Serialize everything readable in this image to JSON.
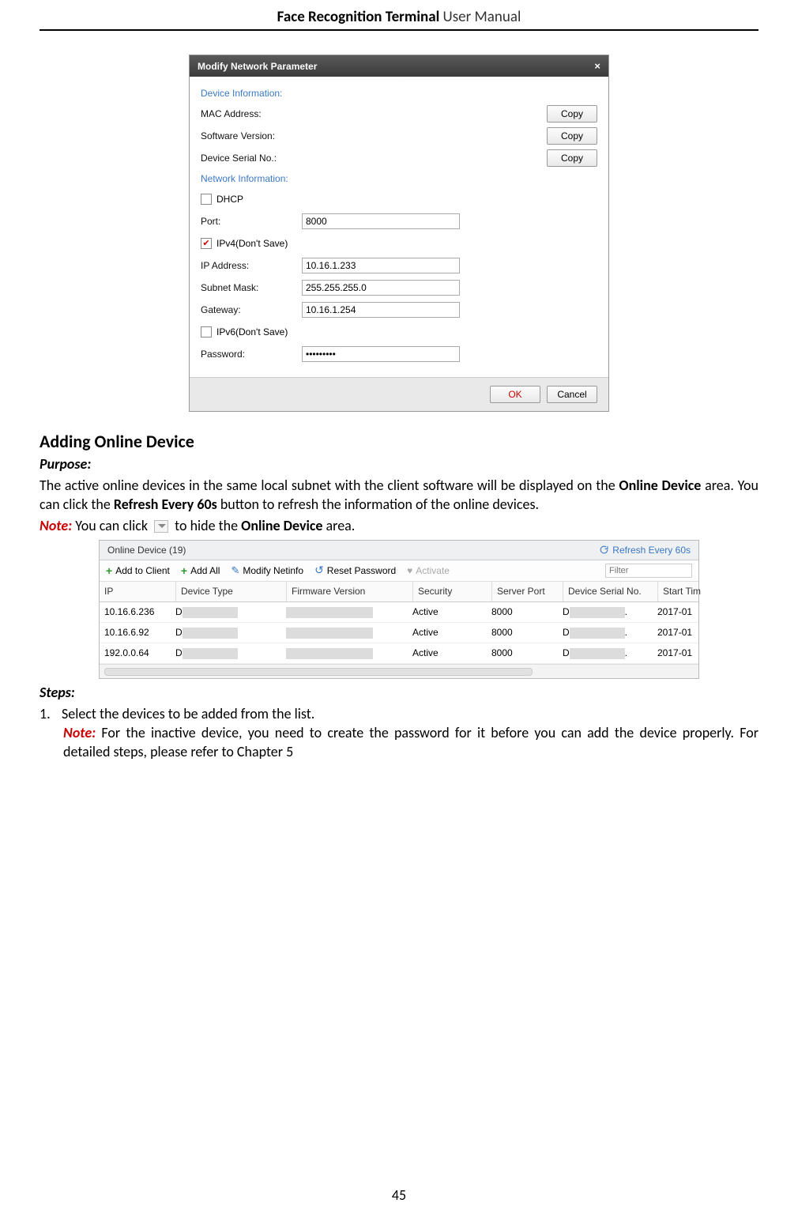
{
  "header": {
    "bold": "Face Recognition Terminal",
    "light": " User Manual"
  },
  "dialog": {
    "title": "Modify Network Parameter",
    "close": "×",
    "device_info_label": "Device Information:",
    "mac_label": "MAC Address:",
    "sw_label": "Software Version:",
    "serial_label": "Device Serial No.:",
    "copy_label": "Copy",
    "net_info_label": "Network Information:",
    "dhcp_label": "DHCP",
    "port_label": "Port:",
    "port_value": "8000",
    "ipv4save_label": "IPv4(Don't Save)",
    "ip_label": "IP Address:",
    "ip_value": "10.16.1.233",
    "subnet_label": "Subnet Mask:",
    "subnet_value": "255.255.255.0",
    "gateway_label": "Gateway:",
    "gateway_value": "10.16.1.254",
    "ipv6save_label": "IPv6(Don't Save)",
    "pwd_label": "Password:",
    "pwd_value": "•••••••••",
    "ok": "OK",
    "cancel": "Cancel"
  },
  "section_title": "Adding Online Device",
  "purpose_label": "Purpose:",
  "para1_a": "The active online devices in the same local subnet with the client software will be displayed on the ",
  "para1_b": "Online Device",
  "para1_c": " area. You can click the ",
  "para1_d": "Refresh Every 60s",
  "para1_e": " button to refresh the information of the online devices.",
  "note_label": "Note:",
  "note_text_a": " You can click ",
  "note_text_b": " to hide the ",
  "note_text_c": "Online Device",
  "note_text_d": " area.",
  "odev": {
    "title": "Online Device (19)",
    "refresh": "Refresh Every 60s",
    "add_client": "Add to Client",
    "add_all": "Add All",
    "modify": "Modify Netinfo",
    "reset": "Reset Password",
    "activate": "Activate",
    "filter_ph": "Filter",
    "cols": [
      "IP",
      "Device Type",
      "Firmware Version",
      "Security",
      "Server Port",
      "Device Serial No.",
      "Start Tim"
    ],
    "rows": [
      {
        "ip": "10.16.6.236",
        "dprefix": "D",
        "sec": "Active",
        "port": "8000",
        "sprefix": "D",
        "date": "2017-01"
      },
      {
        "ip": "10.16.6.92",
        "dprefix": "D",
        "sec": "Active",
        "port": "8000",
        "sprefix": "D",
        "date": "2017-01"
      },
      {
        "ip": "192.0.0.64",
        "dprefix": "D",
        "sec": "Active",
        "port": "8000",
        "sprefix": "D",
        "date": "2017-01"
      }
    ]
  },
  "steps_label": "Steps:",
  "step1_num": "1.",
  "step1_text": "Select the devices to be added from the list.",
  "step1_note": " For the inactive device, you need to create the password for it before you can add the device properly. For detailed steps, please refer to Chapter 5",
  "page_number": "45"
}
